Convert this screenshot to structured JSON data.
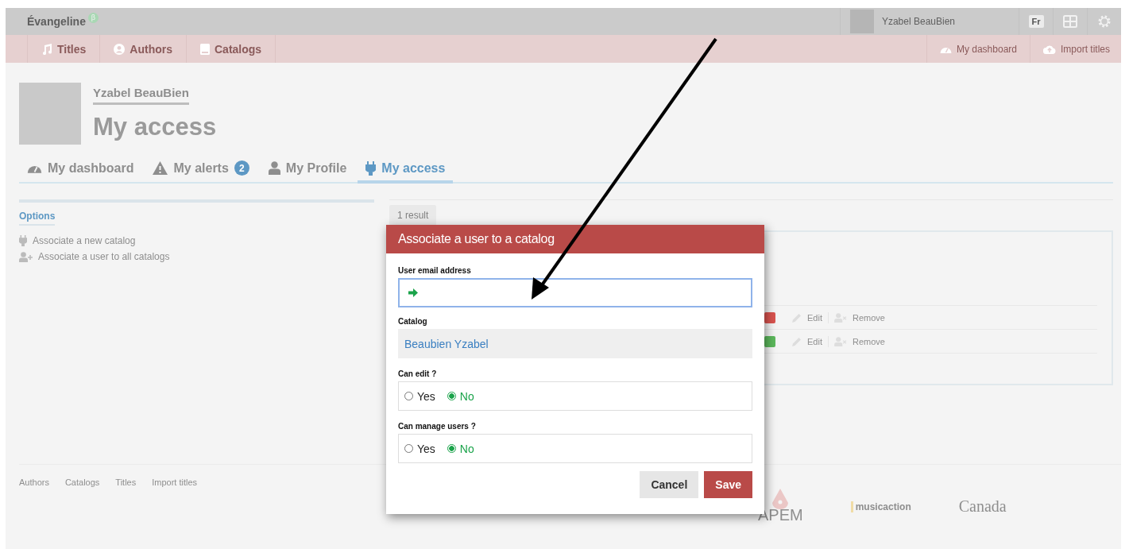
{
  "topbar": {
    "brand": "Évangeline",
    "beta": "β",
    "user": "Yzabel BeauBien",
    "language": "Fr"
  },
  "nav": {
    "items": [
      {
        "label": "Titles"
      },
      {
        "label": "Authors"
      },
      {
        "label": "Catalogs"
      }
    ],
    "right": [
      {
        "label": "My dashboard"
      },
      {
        "label": "Import titles"
      }
    ]
  },
  "profile": {
    "name": "Yzabel BeauBien",
    "title": "My access"
  },
  "tabs": [
    {
      "label": "My dashboard",
      "selected": false
    },
    {
      "label": "My alerts",
      "badge": "2",
      "selected": false
    },
    {
      "label": "My Profile",
      "selected": false
    },
    {
      "label": "My access",
      "selected": true
    }
  ],
  "options": {
    "heading": "Options",
    "items": [
      {
        "label": "Associate a new catalog"
      },
      {
        "label": "Associate a user to all catalogs"
      }
    ]
  },
  "results": {
    "count": "1 result",
    "rows": [
      {
        "color": "#d9534f",
        "edit": "Edit",
        "remove": "Remove"
      },
      {
        "color": "#5cb85c",
        "edit": "Edit",
        "remove": "Remove"
      }
    ]
  },
  "footer": {
    "links": [
      "Authors",
      "Catalogs",
      "Titles",
      "Import titles"
    ],
    "logos": [
      "APEM",
      "musicaction",
      "Canada"
    ]
  },
  "modal": {
    "title": "Associate a user to a catalog",
    "email": {
      "label": "User email address"
    },
    "catalog": {
      "label": "Catalog",
      "value": "Beaubien Yzabel"
    },
    "groups": [
      {
        "label": "Can edit ?",
        "options": [
          {
            "label": "Yes",
            "selected": false
          },
          {
            "label": "No",
            "selected": true
          }
        ]
      },
      {
        "label": "Can manage users ?",
        "options": [
          {
            "label": "Yes",
            "selected": false
          },
          {
            "label": "No",
            "selected": true
          }
        ]
      }
    ],
    "cancel": "Cancel",
    "save": "Save"
  }
}
